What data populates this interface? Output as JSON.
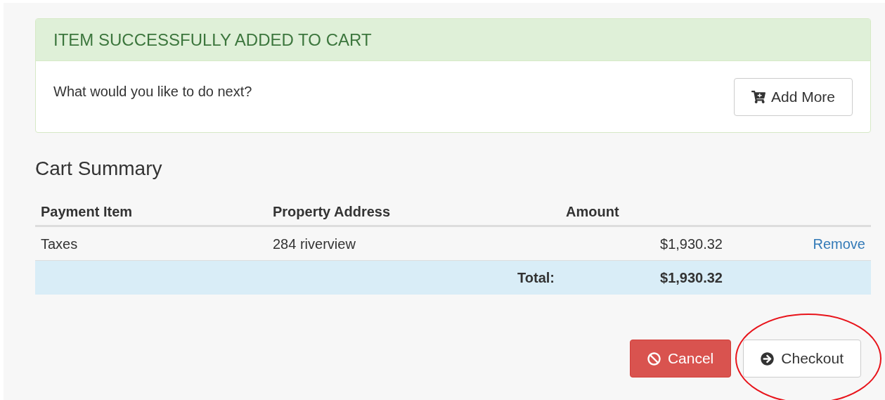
{
  "alert": {
    "title": "ITEM SUCCESSFULLY ADDED TO CART",
    "message": "What would you like to do next?",
    "button": "Add More"
  },
  "cart": {
    "title": "Cart Summary",
    "columns": [
      "Payment Item",
      "Property Address",
      "Amount"
    ],
    "rows": [
      {
        "item": "Taxes",
        "address": "284 riverview",
        "amount": "$1,930.32",
        "action": "Remove"
      }
    ],
    "total": {
      "label": "Total:",
      "amount": "$1,930.32"
    }
  },
  "buttons": [
    {
      "label": "Cancel",
      "kind": "danger",
      "highlighted": false
    },
    {
      "label": "Checkout",
      "kind": "default",
      "highlighted": true
    }
  ]
}
